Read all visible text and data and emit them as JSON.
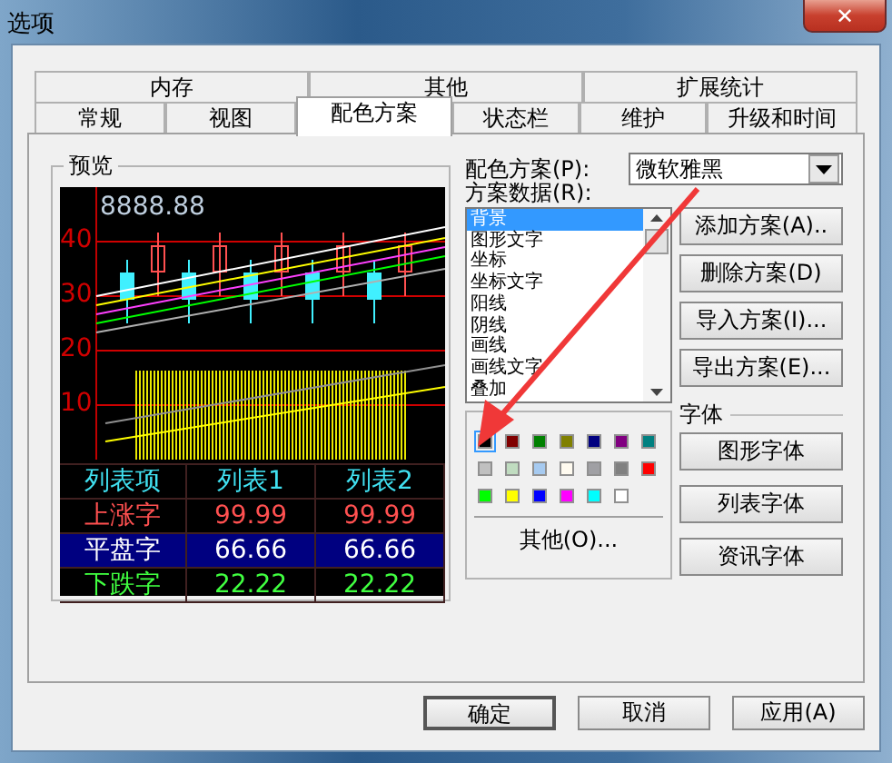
{
  "window": {
    "title": "选项",
    "close": "✕"
  },
  "tab_rows": [
    [
      {
        "label": "内存",
        "selected": false
      },
      {
        "label": "其他",
        "selected": false
      },
      {
        "label": "扩展统计",
        "selected": false
      }
    ],
    [
      {
        "label": "常规",
        "selected": false
      },
      {
        "label": "视图",
        "selected": false
      },
      {
        "label": "配色方案",
        "selected": true
      },
      {
        "label": "状态栏",
        "selected": false
      },
      {
        "label": "维护",
        "selected": false
      },
      {
        "label": "升级和时间",
        "selected": false
      }
    ]
  ],
  "preview": {
    "title": "预览",
    "price": "8888.88",
    "y_labels": [
      "40",
      "30",
      "20",
      "10"
    ],
    "table": [
      {
        "cells": [
          "列表项",
          "列表1",
          "列表2"
        ],
        "kind": "header",
        "selected": false
      },
      {
        "cells": [
          "上涨字",
          "99.99",
          "99.99"
        ],
        "kind": "up",
        "selected": false
      },
      {
        "cells": [
          "平盘字",
          "66.66",
          "66.66"
        ],
        "kind": "flat",
        "selected": true
      },
      {
        "cells": [
          "下跌字",
          "22.22",
          "22.22"
        ],
        "kind": "down",
        "selected": false
      }
    ]
  },
  "scheme": {
    "label": "配色方案(P):",
    "value": "微软雅黑"
  },
  "scheme_data": {
    "label": "方案数据(R):",
    "items": [
      {
        "label": "背景",
        "selected": true
      },
      {
        "label": "图形文字",
        "selected": false
      },
      {
        "label": "坐标",
        "selected": false
      },
      {
        "label": "坐标文字",
        "selected": false
      },
      {
        "label": "阳线",
        "selected": false
      },
      {
        "label": "阴线",
        "selected": false
      },
      {
        "label": "画线",
        "selected": false
      },
      {
        "label": "画线文字",
        "selected": false
      },
      {
        "label": "叠加",
        "selected": false
      }
    ]
  },
  "scheme_buttons": [
    "添加方案(A)..",
    "删除方案(D)",
    "导入方案(I)...",
    "导出方案(E)..."
  ],
  "palette": {
    "colors": [
      {
        "color": "#000000",
        "selected": true
      },
      {
        "color": "#800000",
        "selected": false
      },
      {
        "color": "#008000",
        "selected": false
      },
      {
        "color": "#808000",
        "selected": false
      },
      {
        "color": "#000080",
        "selected": false
      },
      {
        "color": "#800080",
        "selected": false
      },
      {
        "color": "#008080",
        "selected": false
      },
      {
        "color": "#c0c0c0",
        "selected": false
      },
      {
        "color": "#c0dcc0",
        "selected": false
      },
      {
        "color": "#a6caf0",
        "selected": false
      },
      {
        "color": "#fffbf0",
        "selected": false
      },
      {
        "color": "#a0a0a4",
        "selected": false
      },
      {
        "color": "#808080",
        "selected": false
      },
      {
        "color": "#ff0000",
        "selected": false
      },
      {
        "color": "#00ff00",
        "selected": false
      },
      {
        "color": "#ffff00",
        "selected": false
      },
      {
        "color": "#0000ff",
        "selected": false
      },
      {
        "color": "#ff00ff",
        "selected": false
      },
      {
        "color": "#00ffff",
        "selected": false
      },
      {
        "color": "#ffffff",
        "selected": false
      }
    ],
    "other": "其他(O)..."
  },
  "font": {
    "label": "字体",
    "buttons": [
      "图形字体",
      "列表字体",
      "资讯字体"
    ]
  },
  "buttons": [
    "确定",
    "取消",
    "应用(A)"
  ]
}
